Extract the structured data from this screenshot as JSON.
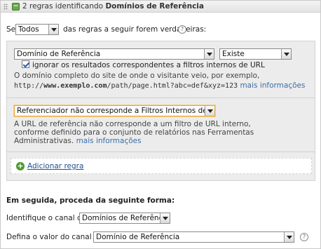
{
  "header": {
    "summary_prefix": "2 regras identificando ",
    "summary_bold": "Domínios de Referência"
  },
  "condition": {
    "se_label": "Se",
    "match_select": "Todos",
    "suffix": "das regras a seguir forem verdadeiras:",
    "help": "?"
  },
  "rule1": {
    "field_select": "Domínio de Referência",
    "operator_select": "Existe",
    "checkbox_label": "ignorar os resultados correspondentes a filtros internos de URL",
    "checkbox_checked": true,
    "desc_line1": "O domínio completo do site de onde o visitante veio, por exemplo,",
    "example_pre": "http://",
    "example_bold": "www.exemplo.com",
    "example_post": "/path/page.html?abc=def&xyz=123",
    "more_info": "mais informações"
  },
  "rule2": {
    "field_select": "Referenciador não corresponde a Filtros Internos de URL",
    "desc_line1": "A URL de referência não corresponde a um filtro de URL interno,",
    "desc_line2": "conforme definido para o conjunto de relatórios nas Ferramentas",
    "desc_line3": "Administrativas.",
    "more_info": "mais informações"
  },
  "add_rule": {
    "label": "Adicionar regra",
    "icon": "plus-icon"
  },
  "then": {
    "title": "Em seguida, proceda da seguinte forma:",
    "identify_label": "Identifique o canal como",
    "identify_select": "Domínios de Referência",
    "value_label": "Defina o valor do canal como",
    "value_select": "Domínio de Referência",
    "help": "?"
  }
}
